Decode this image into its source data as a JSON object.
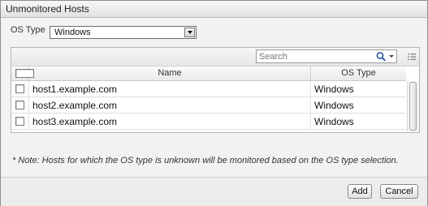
{
  "dialog": {
    "title": "Unmonitored Hosts",
    "os_type_label": "OS Type",
    "os_type_value": "Windows"
  },
  "grid": {
    "search_placeholder": "Search",
    "columns": [
      "Name",
      "OS Type"
    ],
    "rows": [
      {
        "name": "host1.example.com",
        "os": "Windows",
        "checked": false
      },
      {
        "name": "host2.example.com",
        "os": "Windows",
        "checked": false
      },
      {
        "name": "host3.example.com",
        "os": "Windows",
        "checked": false
      }
    ]
  },
  "note": "* Note: Hosts for which the OS type is unknown will be monitored based on the OS type selection.",
  "buttons": {
    "add": "Add",
    "cancel": "Cancel"
  },
  "icons": {
    "dropdown": "chevron-down-icon",
    "search": "magnifier-icon",
    "column_menu": "column-menu-icon"
  }
}
